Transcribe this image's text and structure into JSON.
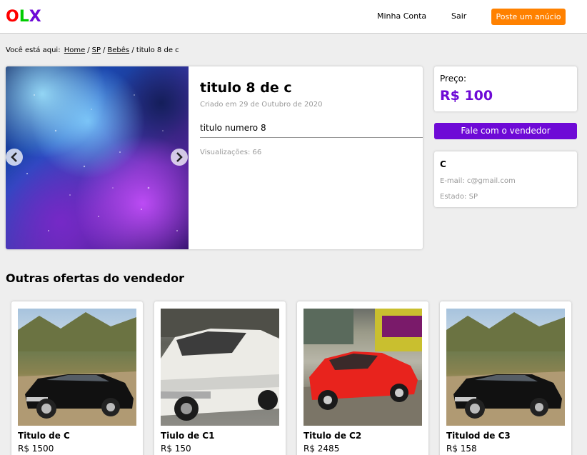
{
  "header": {
    "logo": [
      "O",
      "L",
      "X"
    ],
    "logo_colors": [
      "#ff0000",
      "#00cc00",
      "#6e0ad6"
    ],
    "my_account": "Minha Conta",
    "logout": "Sair",
    "post_ad": "Poste um anúcio"
  },
  "breadcrumb": {
    "prefix": "Você está aqui:",
    "home": "Home",
    "state": "SP",
    "category": "Bebês",
    "current": "/ titulo 8 de c"
  },
  "product": {
    "title": "titulo 8 de c",
    "created": "Criado em 29 de Outubro de 2020",
    "description": "titulo numero 8",
    "views": "Visualizações: 66"
  },
  "price": {
    "label": "Preço:",
    "value": "R$ 100"
  },
  "contact_button": "Fale com o vendedor",
  "seller": {
    "name": "C",
    "email": "E-mail: c@gmail.com",
    "state": "Estado: SP"
  },
  "other_offers": {
    "title": "Outras ofertas do vendedor",
    "items": [
      {
        "title": "Titulo de C",
        "price": "R$ 1500"
      },
      {
        "title": "Tiulo de C1",
        "price": "R$ 150"
      },
      {
        "title": "Titulo de C2",
        "price": "R$ 2485"
      },
      {
        "title": "Titulod de C3",
        "price": "R$ 158"
      }
    ]
  },
  "colors": {
    "accent_purple": "#6e0ad6",
    "accent_orange": "#ff8100"
  }
}
